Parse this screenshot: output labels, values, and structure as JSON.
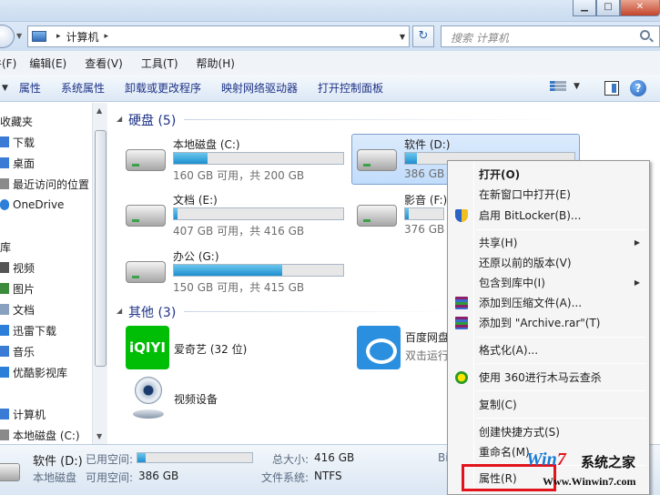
{
  "window": {
    "buttons": {
      "minimize": "▁",
      "maximize": "□",
      "close": "✕"
    }
  },
  "address": {
    "separator": "▸",
    "path": "计算机",
    "dropdown": "▼",
    "refresh": "↻",
    "search_placeholder": "搜索 计算机"
  },
  "menubar": {
    "items": [
      "编辑(E)",
      "查看(V)",
      "工具(T)",
      "帮助(H)"
    ],
    "partial_first": "件(F)"
  },
  "commandbar": {
    "items": [
      "属性",
      "系统属性",
      "卸载或更改程序",
      "映射网络驱动器",
      "打开控制面板"
    ],
    "help": "?"
  },
  "nav": {
    "items": [
      {
        "label": "收藏夹",
        "color": "#f0b73a"
      },
      {
        "label": "下载",
        "color": "#3a7bd5"
      },
      {
        "label": "桌面",
        "color": "#3a7bd5"
      },
      {
        "label": "最近访问的位置",
        "color": "#8a8a8a"
      },
      {
        "label": "OneDrive",
        "color": "#2b7fd9"
      },
      {
        "label": "库",
        "color": "#d9a642"
      },
      {
        "label": "视频",
        "color": "#555555"
      },
      {
        "label": "图片",
        "color": "#3c8c3c"
      },
      {
        "label": "文档",
        "color": "#8aa0bf"
      },
      {
        "label": "迅雷下载",
        "color": "#2b7fd9"
      },
      {
        "label": "音乐",
        "color": "#3a7bd5"
      },
      {
        "label": "优酷影视库",
        "color": "#2b7fd9"
      },
      {
        "label": "计算机",
        "color": "#3a7bd5"
      },
      {
        "label": "本地磁盘 (C:)",
        "color": "#8a8a8a"
      }
    ]
  },
  "content": {
    "groups": [
      {
        "title": "硬盘 (5)"
      },
      {
        "title": "其他 (3)"
      }
    ],
    "drives": [
      {
        "name": "本地磁盘 (C:)",
        "info": "160 GB 可用，共 200 GB",
        "used": 0.2
      },
      {
        "name": "软件 (D:)",
        "info": "386 GB",
        "used": 0.07
      },
      {
        "name": "文档 (E:)",
        "info": "407 GB 可用，共 416 GB",
        "used": 0.02
      },
      {
        "name": "影音 (F:)",
        "info": "376 GB",
        "used": 0.1
      },
      {
        "name": "办公 (G:)",
        "info": "150 GB 可用，共 415 GB",
        "used": 0.64
      }
    ],
    "others": [
      {
        "name": "爱奇艺 (32 位)",
        "icon_text": "iQIYI"
      },
      {
        "name": "百度网盘",
        "sub": "双击运行"
      },
      {
        "name": "视频设备"
      }
    ]
  },
  "details": {
    "drive_name": "软件 (D:)",
    "used_label": "已用空间:",
    "used": 0.07,
    "type": "本地磁盘",
    "free_label": "可用空间:",
    "free_value": "386 GB",
    "total_label": "总大小:",
    "total_value": "416 GB",
    "fs_label": "文件系统:",
    "fs_value": "NTFS",
    "trunc": "Bi"
  },
  "context_menu": {
    "items": [
      {
        "label": "打开(O)",
        "bold": true
      },
      {
        "label": "在新窗口中打开(E)"
      },
      {
        "label": "启用 BitLocker(B)...",
        "icon": "shield"
      },
      {
        "label": "共享(H)",
        "submenu": true
      },
      {
        "label": "还原以前的版本(V)"
      },
      {
        "label": "包含到库中(I)",
        "submenu": true
      },
      {
        "label": "添加到压缩文件(A)...",
        "icon": "rar"
      },
      {
        "label": "添加到 \"Archive.rar\"(T)",
        "icon": "rar"
      },
      {
        "label": "格式化(A)..."
      },
      {
        "label": "使用 360进行木马云查杀",
        "icon": "360"
      },
      {
        "label": "复制(C)"
      },
      {
        "label": "创建快捷方式(S)"
      },
      {
        "label": "重命名(M)"
      },
      {
        "label": "属性(R)"
      }
    ],
    "arrow": "▶"
  },
  "watermark": {
    "logo": "Win7",
    "logo_w": "W",
    "logo_in": "in",
    "logo_7": "7",
    "suffix": "系统之家",
    "url": "Www.Winwin7.com"
  },
  "colors": {
    "accent": "#1e3287",
    "highlight": "#e3131b"
  }
}
